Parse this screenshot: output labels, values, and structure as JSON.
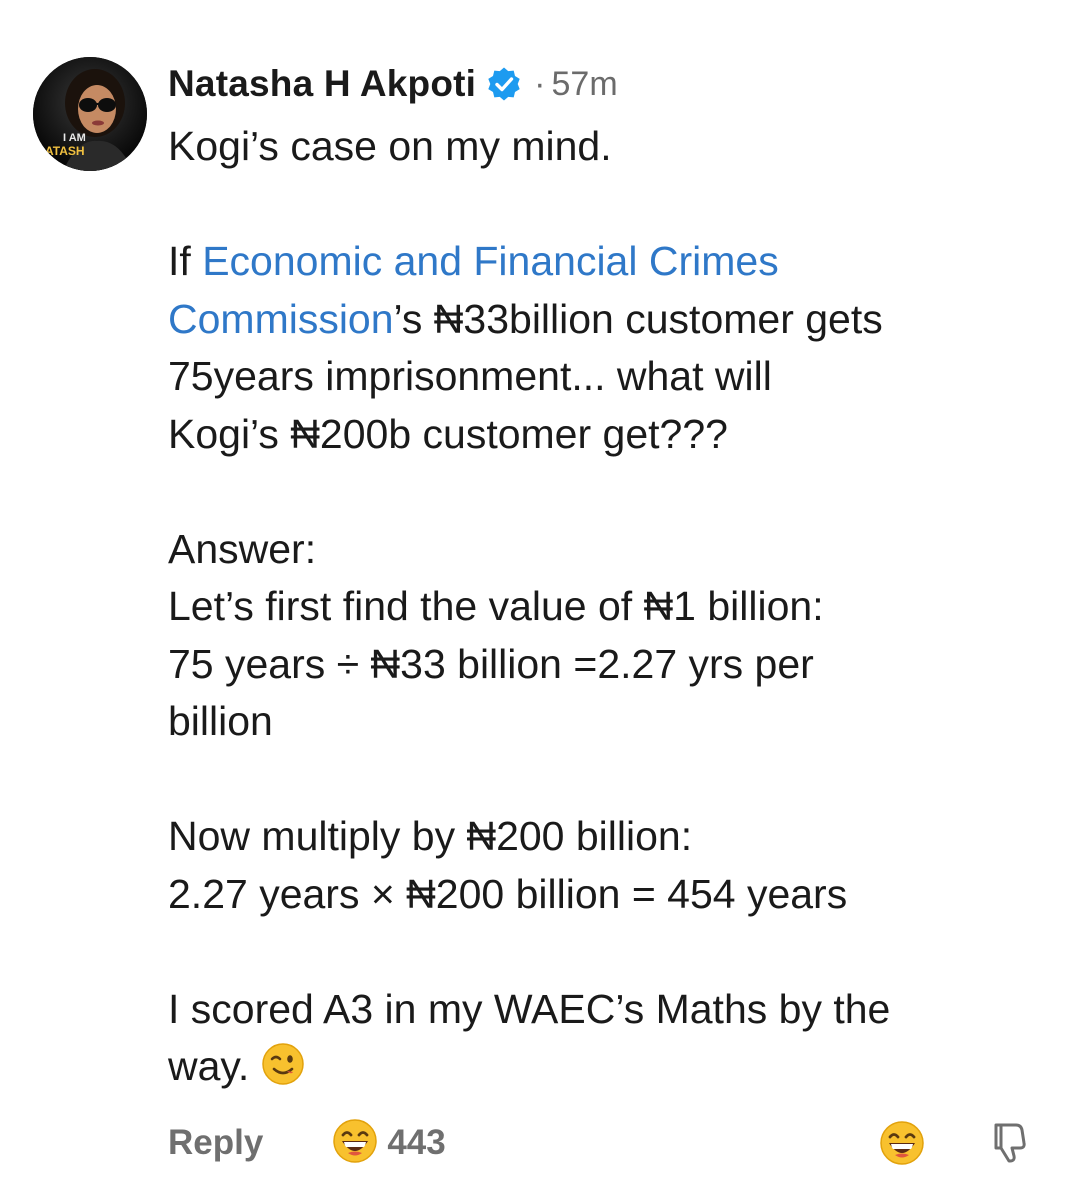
{
  "comment": {
    "author": "Natasha H Akpoti",
    "verified_icon": "verified-badge-icon",
    "separator": "·",
    "timestamp": "57m",
    "avatar_caption_line1": "I AM",
    "avatar_caption_line2": "ATASH",
    "lines": {
      "l1": "Kogi’s case on my mind.",
      "l2_prefix": "If ",
      "l2_link": "Economic and Financial Crimes",
      "l3_link": "Commission",
      "l3_rest": "’s ₦33billion customer gets",
      "l4": "75years imprisonment... what will",
      "l5": "Kogi’s ₦200b customer get???",
      "l6": "Answer:",
      "l7": "Let’s first find the value of ₦1 billion:",
      "l8": "75 years ÷ ₦33 billion =2.27 yrs per",
      "l9": "billion",
      "l10": "Now multiply by ₦200 billion:",
      "l11": "2.27 years × ₦200 billion = 454 years",
      "l12": "I scored A3 in my WAEC’s Maths by the",
      "l13": "way."
    },
    "inline_emoji": "winking-face-emoji"
  },
  "footer": {
    "reply_label": "Reply",
    "reaction_emoji": "grinning-face-emoji",
    "reaction_count": "443",
    "react_button_icon": "grinning-face-emoji",
    "dislike_icon": "thumbs-down-icon"
  },
  "colors": {
    "link": "#2f78c8",
    "text": "#1a1a1a",
    "muted": "#6f6f6f",
    "verified": "#1d9bf0"
  }
}
